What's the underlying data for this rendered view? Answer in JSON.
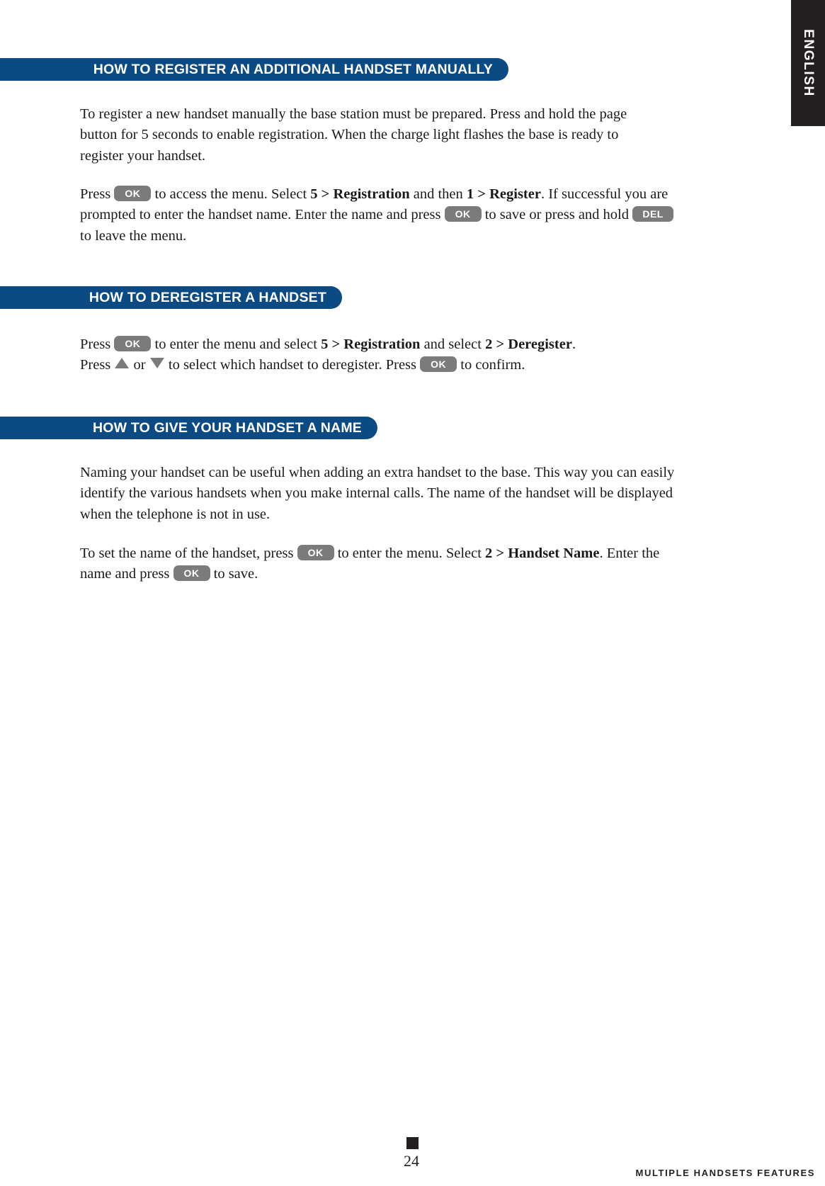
{
  "language_tab": {
    "label": "ENGLISH"
  },
  "sections": [
    {
      "id": "register-manually",
      "heading": "HOW TO REGISTER AN ADDITIONAL HANDSET MANUALLY",
      "paragraphs": [
        {
          "id": "register-intro",
          "text": "To register a new handset manually the base station must be prepared. Press and hold the page button for 5 seconds to enable registration. When the charge light flashes the base is ready to register your handset."
        },
        {
          "id": "register-steps",
          "parts": {
            "t1": "Press ",
            "key1": "OK",
            "t2": " to access the menu. Select ",
            "b1": "5 > Registration",
            "t3": " and then ",
            "b2": "1 > Register",
            "t4": ". If successful you are prompted to enter the handset name. Enter the name and press ",
            "key2": "OK",
            "t5": " to save or press and hold ",
            "key3": "DEL",
            "t6": " to leave the menu."
          }
        }
      ]
    },
    {
      "id": "deregister",
      "heading": "HOW TO DEREGISTER A HANDSET",
      "paragraphs": [
        {
          "id": "deregister-steps",
          "parts": {
            "t1": "Press ",
            "key1": "OK",
            "t2": " to enter the menu and select ",
            "b1": "5 > Registration",
            "t3": " and select ",
            "b2": "2 > Deregister",
            "t4": ".",
            "t5": "Press ",
            "arrow_up": "arrow-up-icon",
            "t6": " or ",
            "arrow_down": "arrow-down-icon",
            "t7": " to select which handset to deregister. Press ",
            "key2": "OK",
            "t8": " to confirm."
          }
        }
      ]
    },
    {
      "id": "handset-name",
      "heading": "HOW TO GIVE YOUR HANDSET A NAME",
      "paragraphs": [
        {
          "id": "name-intro",
          "text": "Naming your handset can be useful when adding an extra handset to the base. This way you can easily identify the various handsets when you make internal calls. The name of the handset will be displayed when the telephone is not in use."
        },
        {
          "id": "name-steps",
          "parts": {
            "t1": "To set the name of the handset, press ",
            "key1": "OK",
            "t2": " to enter the menu. Select ",
            "b1": "2 > Handset Name",
            "t3": ". Enter the name and press ",
            "key2": "OK",
            "t4": " to save."
          }
        }
      ]
    }
  ],
  "footer": {
    "page_number": "24",
    "section_label": "MULTIPLE HANDSETS FEATURES"
  },
  "colors": {
    "bar_blue": "#0b4a82",
    "key_gray": "#7b7b7b",
    "tab_black": "#231f20"
  }
}
